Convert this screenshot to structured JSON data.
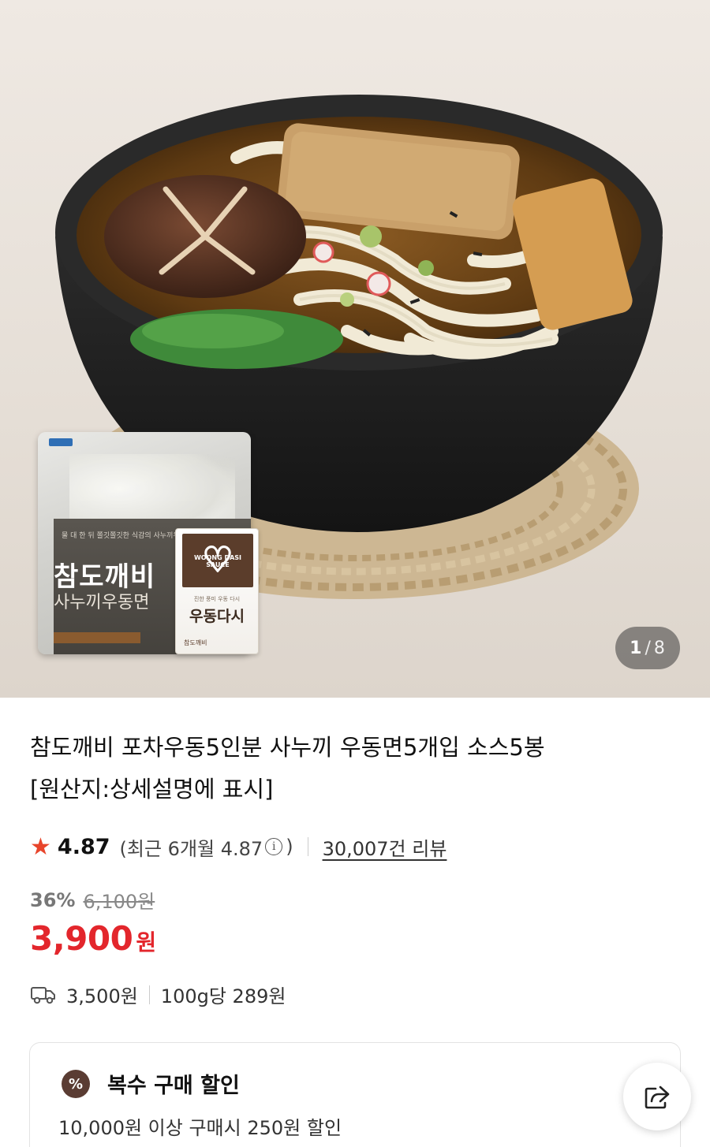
{
  "gallery": {
    "current": "1",
    "separator": "/",
    "total": "8",
    "package": {
      "tiny_text": "물 대 한 뒤 쫄깃쫄깃한 식감의 사누끼우동면",
      "brand": "참도깨비",
      "subtitle": "사누끼우동면",
      "pouch_logo": "WOONG DASI SAUCE",
      "pouch_small": "진한 풍미 우동 다시",
      "pouch_name": "우동다시",
      "pouch_brand": "참도깨비"
    }
  },
  "product": {
    "title_line1": "참도깨비 포차우동5인분 사누끼 우동면5개입 소스5봉",
    "title_line2": "[원산지:상세설명에 표시]"
  },
  "rating": {
    "score": "4.87",
    "recent_prefix": "(최근 6개월 4.87",
    "info_icon": "i",
    "recent_suffix": ")",
    "reviews": "30,007건 리뷰"
  },
  "pricing": {
    "discount_pct": "36%",
    "original_price": "6,100원",
    "sale_amount": "3,900",
    "sale_unit": "원",
    "shipping_fee": "3,500원",
    "unit_price": "100g당 289원"
  },
  "promo": {
    "badge": "%",
    "title": "복수 구매 할인",
    "description": "10,000원 이상 구매시 250원 할인"
  },
  "colors": {
    "accent_red": "#e3262c",
    "star": "#e8452b",
    "badge_brown": "#5a3c33"
  },
  "icons": [
    "star-icon",
    "info-icon",
    "truck-icon",
    "percent-badge-icon",
    "share-icon"
  ]
}
